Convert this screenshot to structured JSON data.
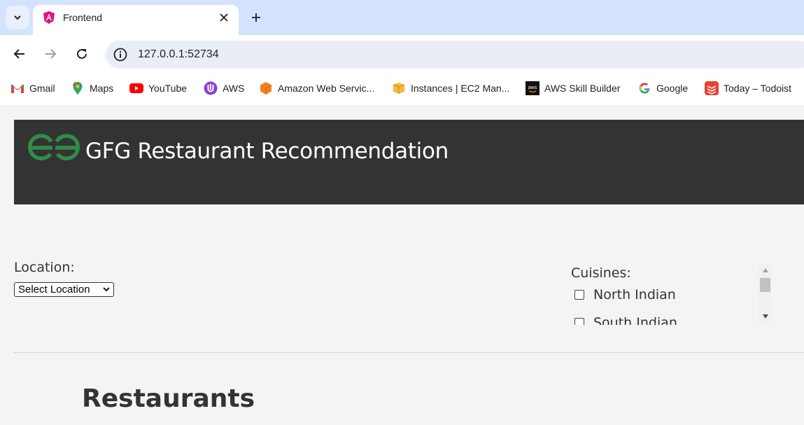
{
  "browser": {
    "tab_title": "Frontend",
    "url": "127.0.0.1:52734",
    "bookmarks": [
      {
        "label": "Gmail",
        "icon": "gmail-icon"
      },
      {
        "label": "Maps",
        "icon": "maps-icon"
      },
      {
        "label": "YouTube",
        "icon": "youtube-icon"
      },
      {
        "label": "AWS",
        "icon": "aws-icon"
      },
      {
        "label": "Amazon Web Servic...",
        "icon": "amazon-web-services-icon"
      },
      {
        "label": "Instances | EC2 Man...",
        "icon": "ec2-icon"
      },
      {
        "label": "AWS Skill Builder",
        "icon": "aws-skill-builder-icon"
      },
      {
        "label": "Google",
        "icon": "google-icon"
      },
      {
        "label": "Today – Todoist",
        "icon": "todoist-icon"
      }
    ]
  },
  "app": {
    "title": "GFG Restaurant Recommendation",
    "logo": "gfg-logo-icon"
  },
  "filters": {
    "location_label": "Location:",
    "location_selected": "Select Location",
    "cuisines_label": "Cuisines:",
    "cuisines": [
      "North Indian",
      "South Indian"
    ]
  },
  "restaurants": {
    "heading": "Restaurants"
  },
  "colors": {
    "header_bg": "#333333",
    "gfg_green": "#2f8d46",
    "page_bg": "#f4f4f4",
    "tabstrip_bg": "#d3e3fd"
  }
}
